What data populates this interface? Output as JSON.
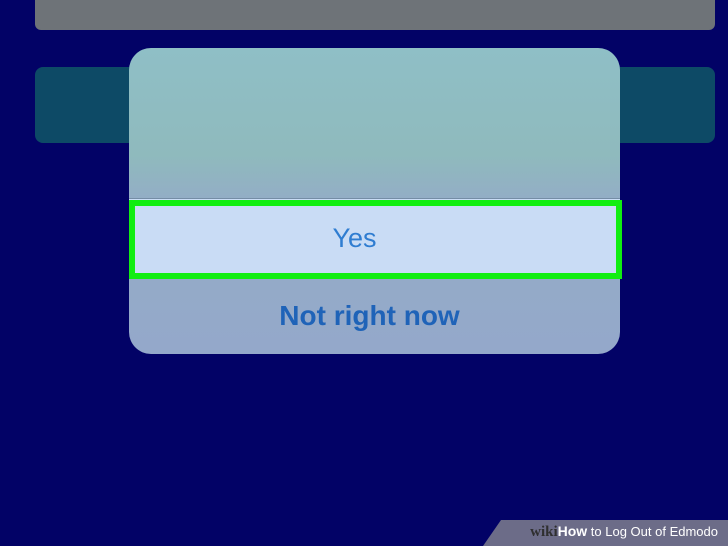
{
  "dialog": {
    "yes_label": "Yes",
    "no_label": "Not right now"
  },
  "watermark": {
    "brand": "wiki",
    "how": "How",
    "title_rest": " to Log Out of Edmodo"
  },
  "colors": {
    "background": "#020266",
    "highlight": "#11ee11",
    "yes_text": "#2f7dd1",
    "no_text": "#1f63b8"
  }
}
